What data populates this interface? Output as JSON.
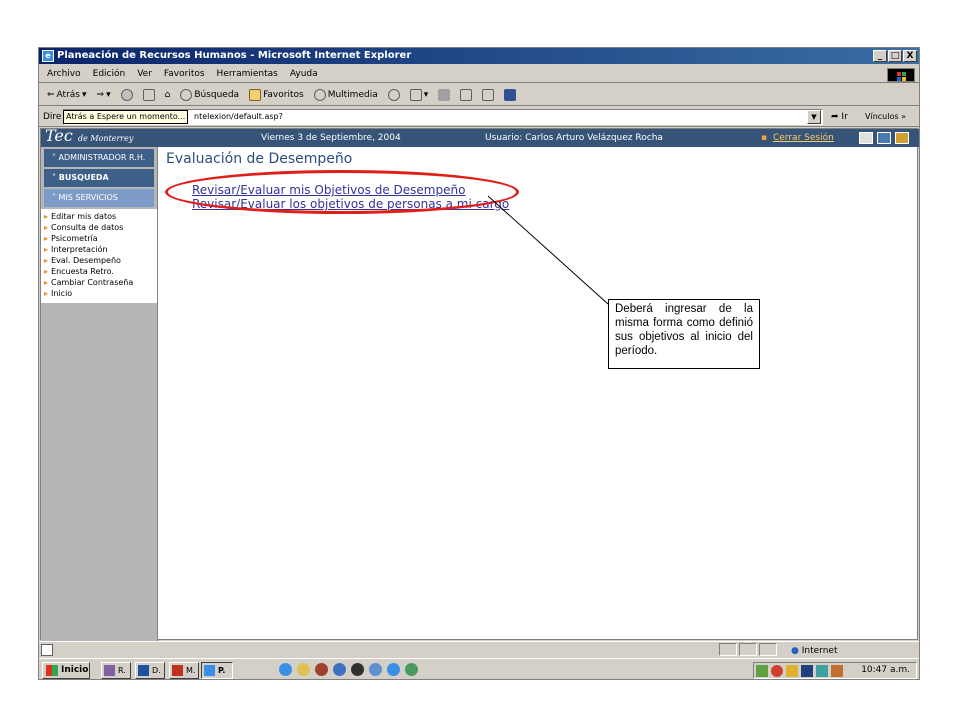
{
  "window": {
    "title": "Planeación de Recursos Humanos - Microsoft Internet Explorer",
    "buttons": [
      "_",
      "□",
      "X"
    ]
  },
  "menu": [
    "Archivo",
    "Edición",
    "Ver",
    "Favoritos",
    "Herramientas",
    "Ayuda"
  ],
  "toolbar": {
    "back_label": "Atrás",
    "search_label": "Búsqueda",
    "favorites_label": "Favoritos",
    "multimedia_label": "Multimedia"
  },
  "tooltip": "Atrás a Espere un momento...",
  "address": {
    "label": "Dire",
    "url_visible": "ntelexion/default.asp?",
    "go_label": "Ir",
    "links_label": "Vínculos"
  },
  "header": {
    "brand": "Tec",
    "brand_sub": "de Monterrey",
    "date": "Viernes 3 de Septiembre, 2004",
    "user": "Usuario: Carlos Arturo Velázquez Rocha",
    "logout": "Cerrar Sesión"
  },
  "sidebar": {
    "sections": [
      {
        "label": "ADMINISTRADOR R.H.",
        "icon": "chevron-up-icon"
      },
      {
        "label": "BUSQUEDA",
        "icon": "chevron-up-icon"
      },
      {
        "label": "MIS SERVICIOS",
        "icon": "chevron-down-icon"
      }
    ],
    "items": [
      "Editar mis datos",
      "Consulta de datos",
      "Psicometría",
      "Interpretación",
      "Eval. Desempeño",
      "Encuesta Retro.",
      "Cambiar Contraseña",
      "Inicio"
    ]
  },
  "main": {
    "title": "Evaluación de Desempeño",
    "links": [
      "Revisar/Evaluar mis Objetivos de Desempeño",
      "Revisar/Evaluar los objetivos de personas a mi cargo"
    ]
  },
  "callout": {
    "text": "Deberá ingresar de la misma forma como definió sus objetivos al inicio del período."
  },
  "status": {
    "zone": "Internet"
  },
  "taskbar": {
    "start_label": "Inicio",
    "tasks": [
      "R.",
      "D.",
      "M.",
      "P."
    ],
    "clock": "10:47 a.m."
  },
  "colors": {
    "titlebar": "#0a246a",
    "header_band": "#365478",
    "sidebar_button": "#3e5f87",
    "link": "#333399",
    "highlight": "#e02018"
  }
}
